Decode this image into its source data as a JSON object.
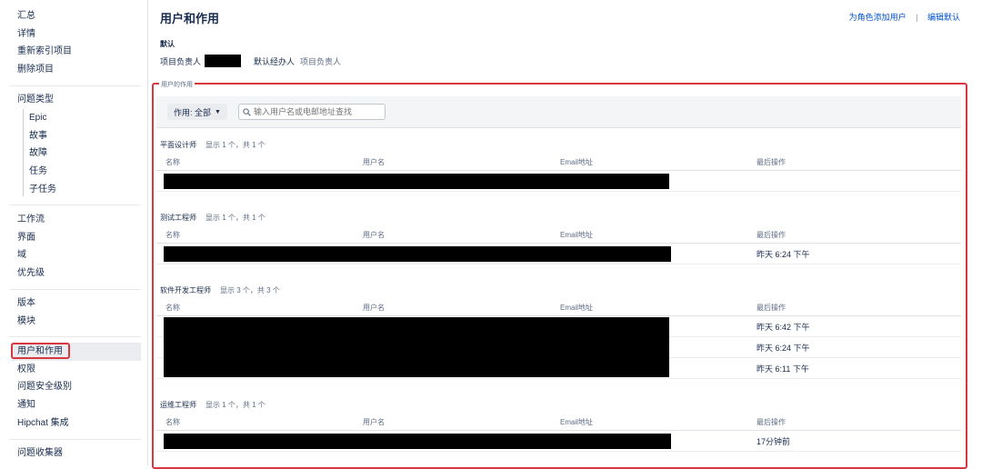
{
  "sidebar": {
    "items": [
      {
        "label": "汇总"
      },
      {
        "label": "详情"
      },
      {
        "label": "重新索引项目"
      },
      {
        "label": "删除项目"
      },
      {
        "label": "问题类型"
      },
      {
        "label": "Epic"
      },
      {
        "label": "故事"
      },
      {
        "label": "故障"
      },
      {
        "label": "任务"
      },
      {
        "label": "子任务"
      },
      {
        "label": "工作流"
      },
      {
        "label": "界面"
      },
      {
        "label": "域"
      },
      {
        "label": "优先级"
      },
      {
        "label": "版本"
      },
      {
        "label": "模块"
      },
      {
        "label": "用户和作用"
      },
      {
        "label": "权限"
      },
      {
        "label": "问题安全级别"
      },
      {
        "label": "通知"
      },
      {
        "label": "Hipchat 集成"
      },
      {
        "label": "问题收集器"
      }
    ],
    "active": "用户和作用"
  },
  "page": {
    "title": "用户和作用",
    "add_users_link": "为角色添加用户",
    "separator": "|",
    "edit_defaults_link": "编辑默认"
  },
  "defaults": {
    "label": "默认",
    "project_lead_label": "项目负责人",
    "default_assignee_label": "默认经办人",
    "default_assignee_value": "项目负责人"
  },
  "roles": {
    "label": "用户的作用",
    "filter_label": "作用: 全部",
    "search_placeholder": "输入用户名或电邮地址查找",
    "columns": {
      "name": "名称",
      "username": "用户名",
      "email": "Email地址",
      "last_action": "最后操作"
    },
    "sections": [
      {
        "name": "平面设计师",
        "count": "显示 1 个，共 1 个",
        "rows": [
          ""
        ]
      },
      {
        "name": "测试工程师",
        "count": "显示 1 个，共 1 个",
        "rows": [
          "昨天 6:24 下午"
        ]
      },
      {
        "name": "软件开发工程师",
        "count": "显示 3 个，共 3 个",
        "rows": [
          "昨天 6:42 下午",
          "昨天 6:24 下午",
          "昨天 6:11 下午"
        ]
      },
      {
        "name": "运维工程师",
        "count": "显示 1 个，共 1 个",
        "rows": [
          "17分钟前"
        ]
      }
    ]
  },
  "colors": {
    "accent": "#0052cc",
    "highlight": "#d7373f"
  }
}
